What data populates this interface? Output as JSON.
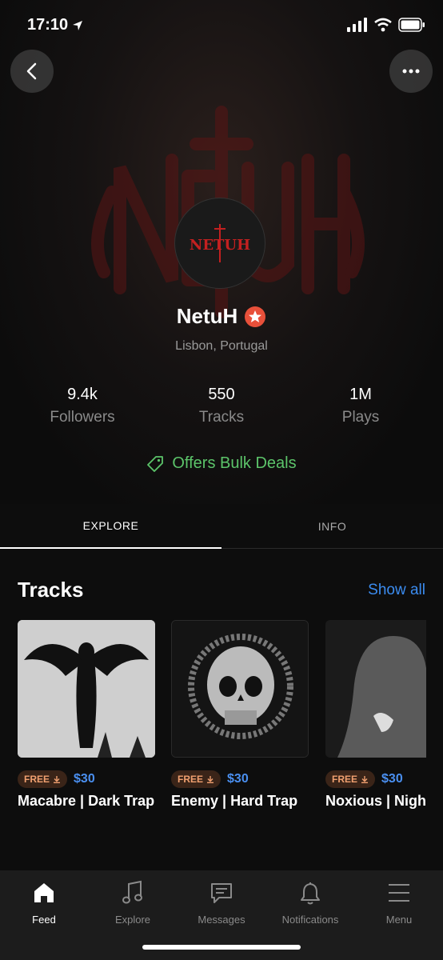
{
  "status_bar": {
    "time": "17:10"
  },
  "artist": {
    "name": "NetuH",
    "logo_text": "NΕTUH",
    "location": "Lisbon, Portugal",
    "verified_color": "#e8503a"
  },
  "stats": [
    {
      "value": "9.4k",
      "label": "Followers"
    },
    {
      "value": "550",
      "label": "Tracks"
    },
    {
      "value": "1M",
      "label": "Plays"
    }
  ],
  "bulk_deals": {
    "label": "Offers Bulk Deals",
    "color": "#5cc46a"
  },
  "tabs": [
    {
      "label": "EXPLORE",
      "active": true
    },
    {
      "label": "INFO",
      "active": false
    }
  ],
  "tracks_section": {
    "title": "Tracks",
    "show_all": "Show all",
    "items": [
      {
        "badge": "FREE",
        "price": "$30",
        "title": "Macabre | Dark Trap"
      },
      {
        "badge": "FREE",
        "price": "$30",
        "title": "Enemy | Hard Trap"
      },
      {
        "badge": "FREE",
        "price": "$30",
        "title": "Noxious | Night"
      }
    ]
  },
  "bottom_nav": [
    {
      "label": "Feed",
      "icon": "home-icon",
      "active": true
    },
    {
      "label": "Explore",
      "icon": "music-note-icon",
      "active": false
    },
    {
      "label": "Messages",
      "icon": "message-icon",
      "active": false
    },
    {
      "label": "Notifications",
      "icon": "bell-icon",
      "active": false
    },
    {
      "label": "Menu",
      "icon": "menu-icon",
      "active": false
    }
  ]
}
